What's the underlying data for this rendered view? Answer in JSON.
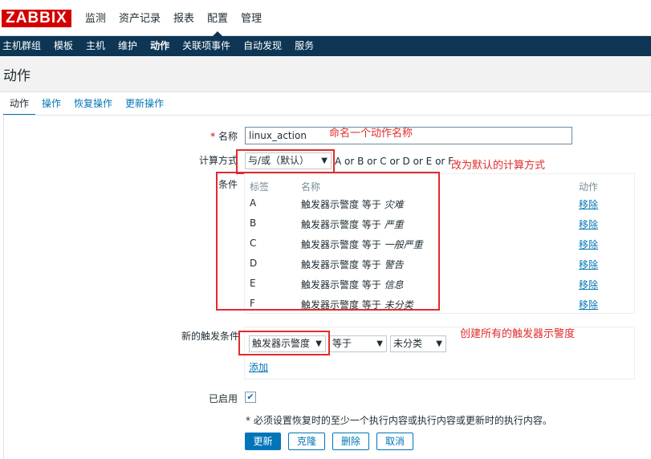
{
  "app": {
    "logo": "ZABBIX"
  },
  "topnav": [
    "监测",
    "资产记录",
    "报表",
    "配置",
    "管理"
  ],
  "subnav": [
    "主机群组",
    "模板",
    "主机",
    "维护",
    "动作",
    "关联项事件",
    "自动发现",
    "服务"
  ],
  "page": {
    "title": "动作"
  },
  "tabs": [
    "动作",
    "操作",
    "恢复操作",
    "更新操作"
  ],
  "form": {
    "name_required": "*",
    "name_label": "名称",
    "name_value": "linux_action",
    "calc_label": "计算方式",
    "calc_value": "与/或（默认）",
    "calc_formula": "A or B or C or D or E or F",
    "conditions_label": "条件",
    "cond_headers": {
      "label": "标签",
      "name": "名称",
      "action": "动作"
    },
    "conditions": [
      {
        "label": "A",
        "prefix": "触发器示警度 等于 ",
        "value": "灾难",
        "action": "移除"
      },
      {
        "label": "B",
        "prefix": "触发器示警度 等于 ",
        "value": "严重",
        "action": "移除"
      },
      {
        "label": "C",
        "prefix": "触发器示警度 等于 ",
        "value": "一般严重",
        "action": "移除"
      },
      {
        "label": "D",
        "prefix": "触发器示警度 等于 ",
        "value": "警告",
        "action": "移除"
      },
      {
        "label": "E",
        "prefix": "触发器示警度 等于 ",
        "value": "信息",
        "action": "移除"
      },
      {
        "label": "F",
        "prefix": "触发器示警度 等于 ",
        "value": "未分类",
        "action": "移除"
      }
    ],
    "new_cond_label": "新的触发条件",
    "new_cond_type": "触发器示警度",
    "new_cond_operator": "等于",
    "new_cond_value": "未分类",
    "add_link": "添加",
    "enabled_label": "已启用",
    "enabled_check": "✔",
    "note": "* 必须设置恢复时的至少一个执行内容或执行内容或更新时的执行内容。"
  },
  "buttons": {
    "update": "更新",
    "clone": "克隆",
    "delete": "删除",
    "cancel": "取消"
  },
  "annotations": {
    "name": "命名一个动作名称",
    "calc": "改为默认的计算方式",
    "new_cond": "创建所有的触发器示警度"
  },
  "colors": {
    "brand": "#d40000",
    "nav": "#0e3654",
    "link": "#0275b8",
    "annotation": "#e12b2b"
  },
  "icons": {
    "dropdown": "dropdown-arrow-icon",
    "checkbox": "check-icon"
  }
}
